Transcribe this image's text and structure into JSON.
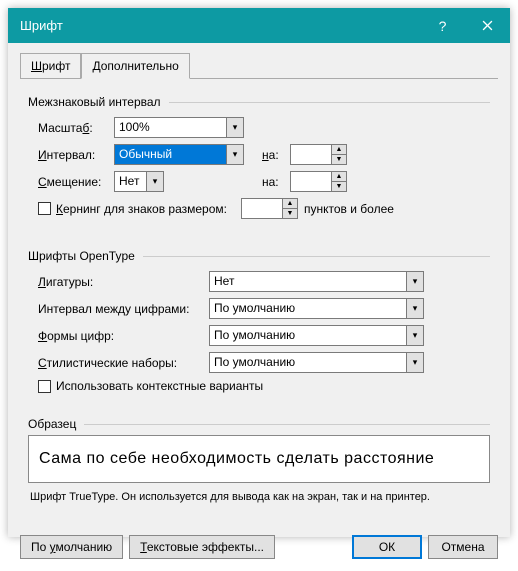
{
  "window": {
    "title": "Шрифт"
  },
  "tabs": {
    "font": "Шрифт",
    "advanced": "Дополнительно",
    "font_ul": "Ш",
    "adv_ul": "Д"
  },
  "spacing": {
    "legend": "Межзнаковый интервал",
    "scale_label": "Масштаб:",
    "scale_ul": "б",
    "scale_value": "100%",
    "interval_label": "Интервал:",
    "interval_ul": "И",
    "interval_value": "Обычный",
    "na1": "на:",
    "na1_ul": "н",
    "offset_label": "Смещение:",
    "offset_ul": "С",
    "offset_value": "Нет",
    "na2": "на:",
    "kerning_label": "Кернинг для знаков размером:",
    "kerning_ul": "К",
    "kerning_suffix": "пунктов и более"
  },
  "opentype": {
    "legend": "Шрифты OpenType",
    "ligatures_label": "Лигатуры:",
    "ligatures_ul": "Л",
    "ligatures_value": "Нет",
    "numspacing_label": "Интервал между цифрами:",
    "numspacing_value": "По умолчанию",
    "numforms_label": "Формы цифр:",
    "numforms_ul": "Ф",
    "numforms_value": "По умолчанию",
    "stylistic_label": "Стилистические наборы:",
    "stylistic_ul": "С",
    "stylistic_value": "По умолчанию",
    "contextual_label": "Использовать контекстные варианты"
  },
  "sample": {
    "legend": "Образец",
    "text": "Сама  по  себе  необходимость  сделать  расстояние",
    "desc": "Шрифт TrueType. Он используется для вывода как на экран, так и на принтер."
  },
  "buttons": {
    "default": "По умолчанию",
    "default_ul": "у",
    "texteffects": "Текстовые эффекты...",
    "texteffects_ul": "Т",
    "ok": "ОК",
    "cancel": "Отмена"
  }
}
